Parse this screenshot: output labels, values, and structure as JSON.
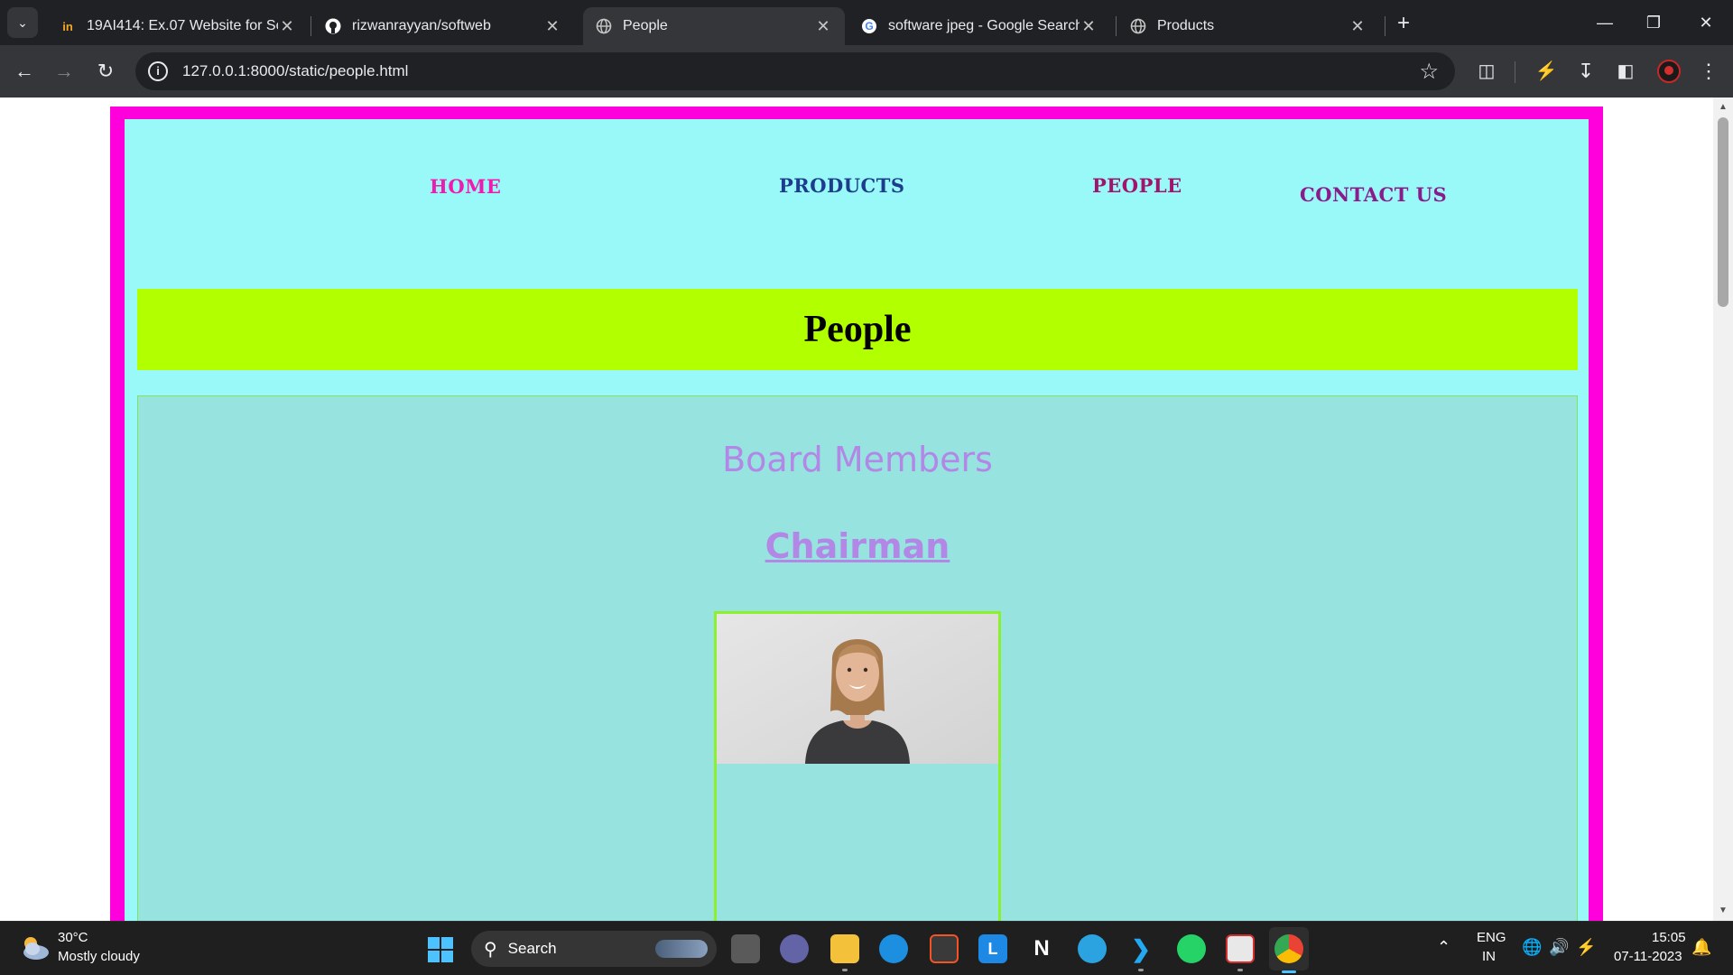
{
  "browser": {
    "tabs": [
      {
        "title": "19AI414: Ex.07 Website for Soft",
        "favicon": "itext-icon",
        "active": false
      },
      {
        "title": "rizwanrayyan/softweb",
        "favicon": "github-icon",
        "active": false
      },
      {
        "title": "People",
        "favicon": "globe-icon",
        "active": true
      },
      {
        "title": "software jpeg - Google Search",
        "favicon": "google-icon",
        "active": false
      },
      {
        "title": "Products",
        "favicon": "globe-icon",
        "active": false
      }
    ],
    "url": "127.0.0.1:8000/static/people.html"
  },
  "page": {
    "nav": {
      "home": "HOME",
      "products": "PRODUCTS",
      "people": "PEOPLE",
      "contact": "CONTACT US"
    },
    "banner_title": "People",
    "section_title": "Board Members",
    "role_title": "Chairman",
    "colors": {
      "frame": "#ff00dd",
      "background": "#98f9f8",
      "banner": "#b2ff00",
      "content": "#96e3e0",
      "heading": "#b287e6",
      "card_border": "#8df02b"
    }
  },
  "taskbar": {
    "weather_temp": "30°C",
    "weather_desc": "Mostly cloudy",
    "search_label": "Search",
    "lang_top": "ENG",
    "lang_bottom": "IN",
    "time": "15:05",
    "date": "07-11-2023"
  }
}
